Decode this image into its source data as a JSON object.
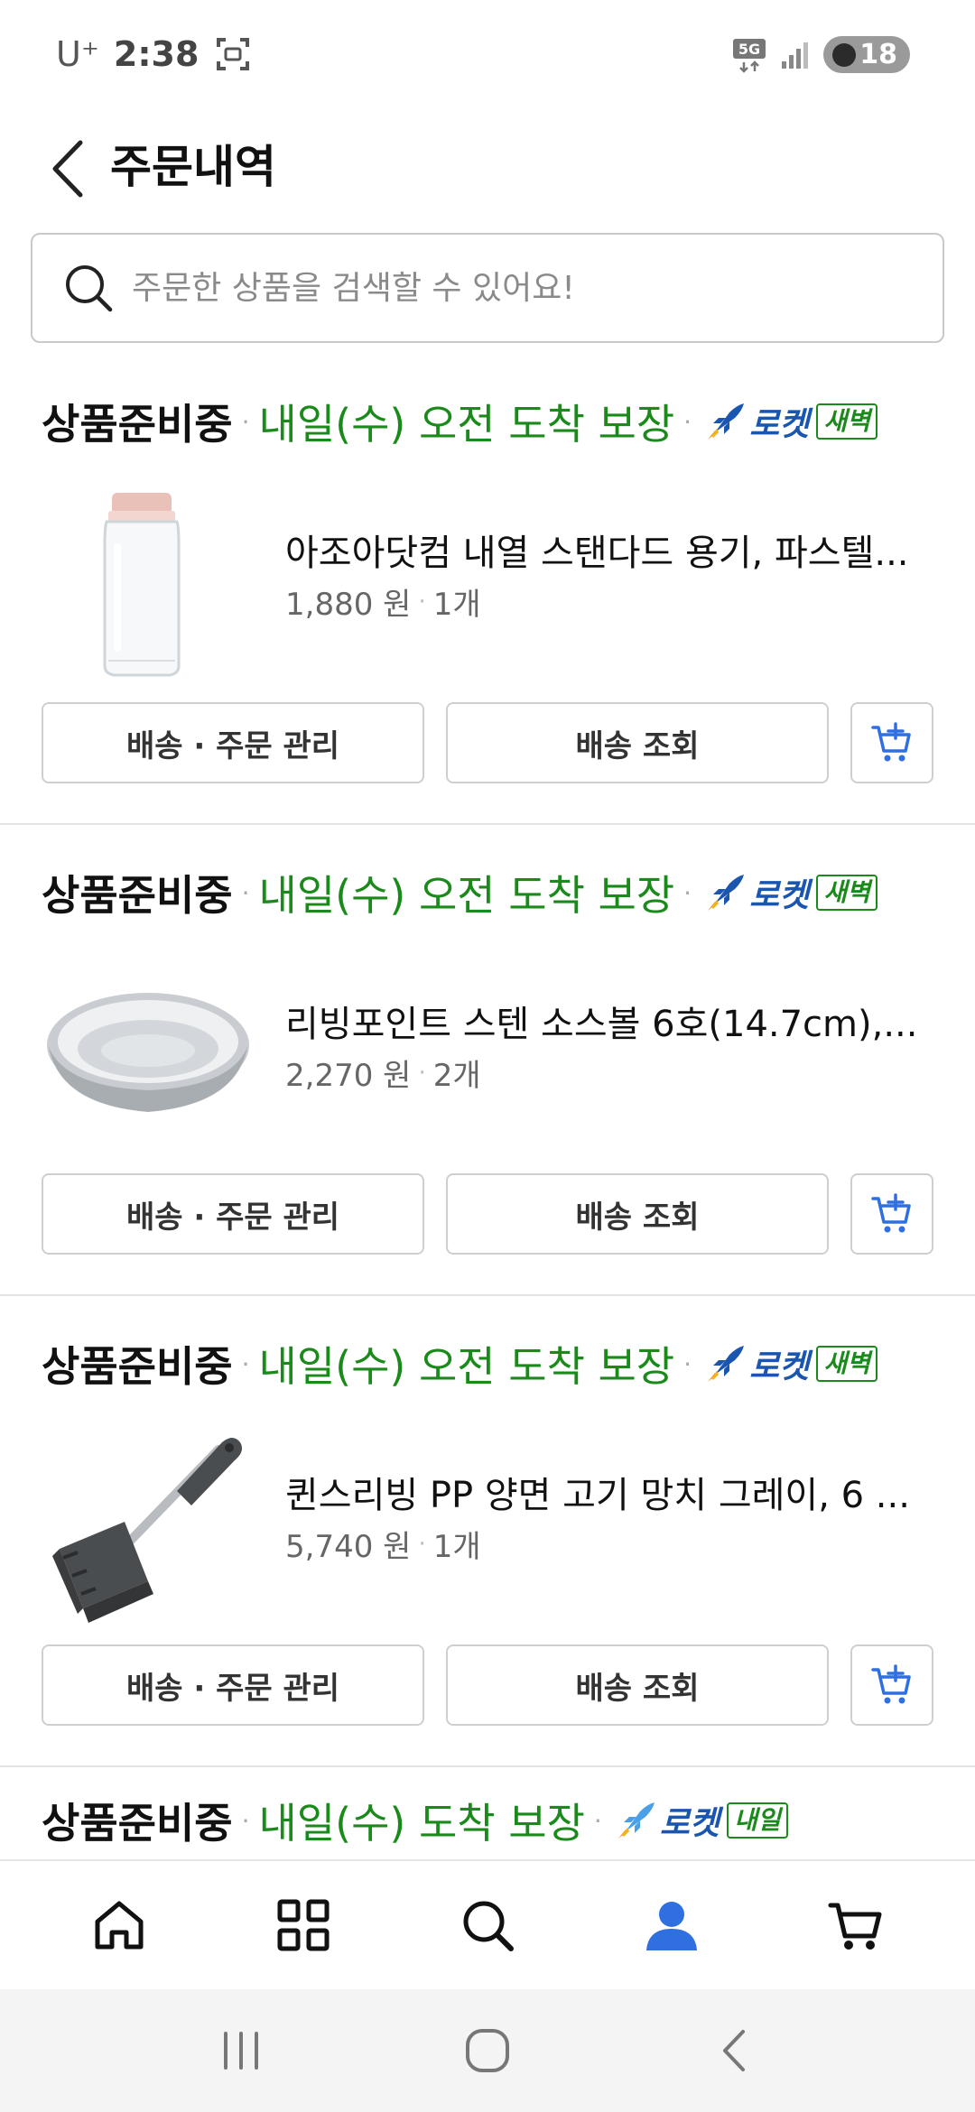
{
  "status_bar": {
    "carrier": "U⁺",
    "time": "2:38",
    "network": "5G",
    "battery": "18"
  },
  "header": {
    "title": "주문내역"
  },
  "search": {
    "placeholder": "주문한 상품을 검색할 수 있어요!"
  },
  "orders": [
    {
      "status": "상품준비중",
      "arrival": "내일(수) 오전 도착 보장",
      "rocket_label": "로켓",
      "rocket_tag": "새벽",
      "product_name": "아조아닷컴 내열 스탠다드 용기, 파스텔...",
      "price": "1,880 원",
      "quantity": "1개",
      "manage_label": "배송 · 주문 관리",
      "track_label": "배송 조회",
      "image": "clear-bottle"
    },
    {
      "status": "상품준비중",
      "arrival": "내일(수) 오전 도착 보장",
      "rocket_label": "로켓",
      "rocket_tag": "새벽",
      "product_name": "리빙포인트 스텐 소스볼 6호(14.7cm),...",
      "price": "2,270 원",
      "quantity": "2개",
      "manage_label": "배송 · 주문 관리",
      "track_label": "배송 조회",
      "image": "steel-bowl"
    },
    {
      "status": "상품준비중",
      "arrival": "내일(수) 오전 도착 보장",
      "rocket_label": "로켓",
      "rocket_tag": "새벽",
      "product_name": "퀸스리빙 PP 양면 고기 망치 그레이, 6 ...",
      "price": "5,740 원",
      "quantity": "1개",
      "manage_label": "배송 · 주문 관리",
      "track_label": "배송 조회",
      "image": "meat-mallet"
    },
    {
      "status": "상품준비중",
      "arrival": "내일(수) 도착 보장",
      "rocket_label": "로켓",
      "rocket_tag": "내일"
    }
  ],
  "bottom_nav": [
    "home-icon",
    "categories-icon",
    "search-icon",
    "my-page-icon",
    "cart-icon"
  ],
  "colors": {
    "arrival_green": "#1a8a1a",
    "rocket_blue": "#1a56b0",
    "active_nav": "#2f6fe0",
    "cart_button_icon": "#2f6fe0"
  }
}
